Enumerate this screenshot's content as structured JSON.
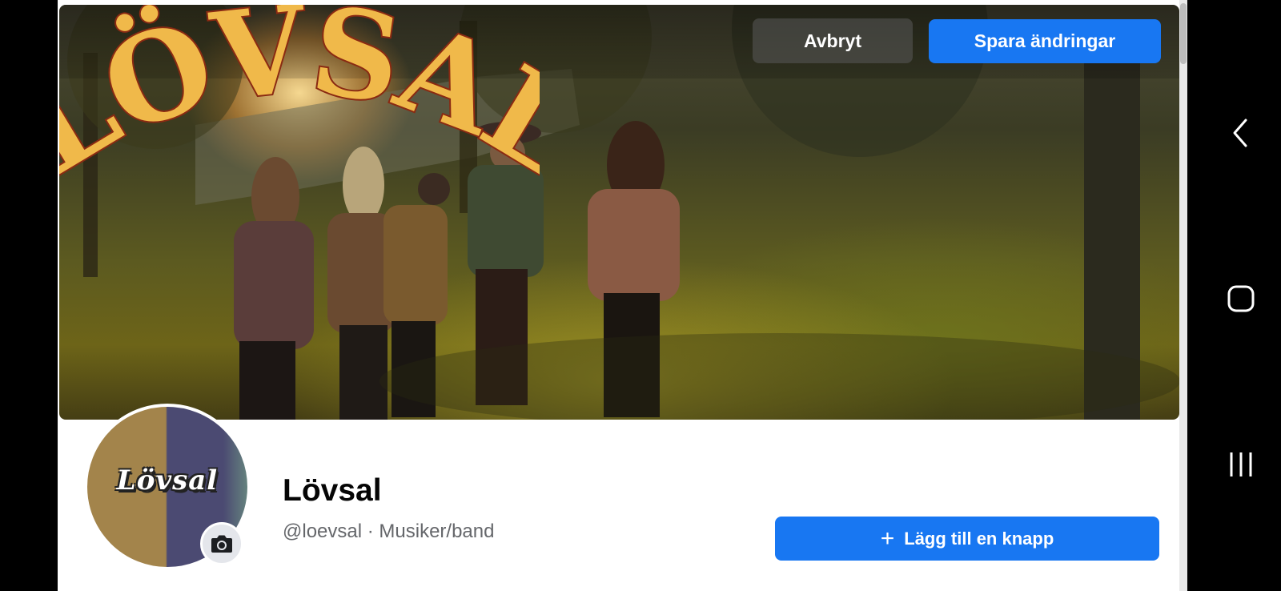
{
  "cover": {
    "cancel_label": "Avbryt",
    "save_label": "Spara ändringar",
    "band_logo_text": "LÖVSAL"
  },
  "profile": {
    "avatar_logo_text": "Lövsal",
    "name": "Lövsal",
    "handle": "@loevsal · Musiker/band",
    "add_button_icon": "+",
    "add_button_label": "Lägg till en knapp"
  },
  "icons": {
    "camera": "camera-icon",
    "back": "back-icon",
    "home": "home-icon",
    "recents": "recent-apps-icon"
  },
  "colors": {
    "primary": "#1877f2",
    "logo_yellow": "#f0b94a",
    "logo_outline": "#8a2a12"
  }
}
